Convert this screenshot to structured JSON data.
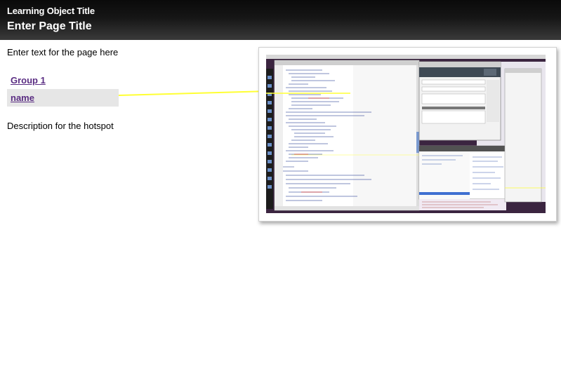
{
  "header": {
    "learning_object_title": "Learning Object Title",
    "page_title": "Enter Page Title"
  },
  "content": {
    "intro_text": "Enter text for the page here",
    "group_label": "Group 1",
    "hotspot_label": "name",
    "hotspot_description": "Description for the hotspot"
  },
  "colors": {
    "header_bg": "#111111",
    "link": "#5a2d82",
    "hotspot_bg": "#e6e6e6",
    "connector": "#ffff33"
  }
}
